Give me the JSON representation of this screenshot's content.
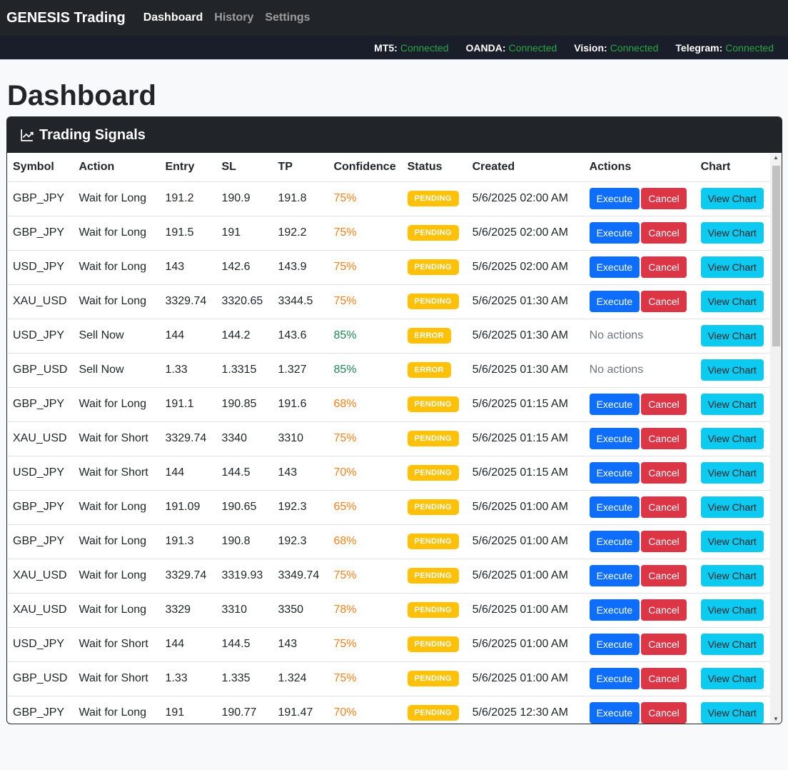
{
  "nav": {
    "brand": "GENESIS Trading",
    "links": [
      "Dashboard",
      "History",
      "Settings"
    ]
  },
  "status": [
    {
      "key": "MT5:",
      "value": "Connected"
    },
    {
      "key": "OANDA:",
      "value": "Connected"
    },
    {
      "key": "Vision:",
      "value": "Connected"
    },
    {
      "key": "Telegram:",
      "value": "Connected"
    }
  ],
  "page_title": "Dashboard",
  "card_title": "Trading Signals",
  "columns": [
    "Symbol",
    "Action",
    "Entry",
    "SL",
    "TP",
    "Confidence",
    "Status",
    "Created",
    "Actions",
    "Chart"
  ],
  "labels": {
    "execute": "Execute",
    "cancel": "Cancel",
    "view_chart": "View Chart",
    "no_actions": "No actions"
  },
  "rows": [
    {
      "symbol": "GBP_JPY",
      "action": "Wait for Long",
      "entry": "191.2",
      "sl": "190.9",
      "tp": "191.8",
      "confidence": "75%",
      "status": "PENDING",
      "created": "5/6/2025 02:00 AM"
    },
    {
      "symbol": "GBP_JPY",
      "action": "Wait for Long",
      "entry": "191.5",
      "sl": "191",
      "tp": "192.2",
      "confidence": "75%",
      "status": "PENDING",
      "created": "5/6/2025 02:00 AM"
    },
    {
      "symbol": "USD_JPY",
      "action": "Wait for Long",
      "entry": "143",
      "sl": "142.6",
      "tp": "143.9",
      "confidence": "75%",
      "status": "PENDING",
      "created": "5/6/2025 02:00 AM"
    },
    {
      "symbol": "XAU_USD",
      "action": "Wait for Long",
      "entry": "3329.74",
      "sl": "3320.65",
      "tp": "3344.5",
      "confidence": "75%",
      "status": "PENDING",
      "created": "5/6/2025 01:30 AM"
    },
    {
      "symbol": "USD_JPY",
      "action": "Sell Now",
      "entry": "144",
      "sl": "144.2",
      "tp": "143.6",
      "confidence": "85%",
      "status": "ERROR",
      "created": "5/6/2025 01:30 AM"
    },
    {
      "symbol": "GBP_USD",
      "action": "Sell Now",
      "entry": "1.33",
      "sl": "1.3315",
      "tp": "1.327",
      "confidence": "85%",
      "status": "ERROR",
      "created": "5/6/2025 01:30 AM"
    },
    {
      "symbol": "GBP_JPY",
      "action": "Wait for Long",
      "entry": "191.1",
      "sl": "190.85",
      "tp": "191.6",
      "confidence": "68%",
      "status": "PENDING",
      "created": "5/6/2025 01:15 AM"
    },
    {
      "symbol": "XAU_USD",
      "action": "Wait for Short",
      "entry": "3329.74",
      "sl": "3340",
      "tp": "3310",
      "confidence": "75%",
      "status": "PENDING",
      "created": "5/6/2025 01:15 AM"
    },
    {
      "symbol": "USD_JPY",
      "action": "Wait for Short",
      "entry": "144",
      "sl": "144.5",
      "tp": "143",
      "confidence": "70%",
      "status": "PENDING",
      "created": "5/6/2025 01:15 AM"
    },
    {
      "symbol": "GBP_JPY",
      "action": "Wait for Long",
      "entry": "191.09",
      "sl": "190.65",
      "tp": "192.3",
      "confidence": "65%",
      "status": "PENDING",
      "created": "5/6/2025 01:00 AM"
    },
    {
      "symbol": "GBP_JPY",
      "action": "Wait for Long",
      "entry": "191.3",
      "sl": "190.8",
      "tp": "192.3",
      "confidence": "68%",
      "status": "PENDING",
      "created": "5/6/2025 01:00 AM"
    },
    {
      "symbol": "XAU_USD",
      "action": "Wait for Long",
      "entry": "3329.74",
      "sl": "3319.93",
      "tp": "3349.74",
      "confidence": "75%",
      "status": "PENDING",
      "created": "5/6/2025 01:00 AM"
    },
    {
      "symbol": "XAU_USD",
      "action": "Wait for Long",
      "entry": "3329",
      "sl": "3310",
      "tp": "3350",
      "confidence": "78%",
      "status": "PENDING",
      "created": "5/6/2025 01:00 AM"
    },
    {
      "symbol": "USD_JPY",
      "action": "Wait for Short",
      "entry": "144",
      "sl": "144.5",
      "tp": "143",
      "confidence": "75%",
      "status": "PENDING",
      "created": "5/6/2025 01:00 AM"
    },
    {
      "symbol": "GBP_USD",
      "action": "Wait for Short",
      "entry": "1.33",
      "sl": "1.335",
      "tp": "1.324",
      "confidence": "75%",
      "status": "PENDING",
      "created": "5/6/2025 01:00 AM"
    },
    {
      "symbol": "GBP_JPY",
      "action": "Wait for Long",
      "entry": "191",
      "sl": "190.77",
      "tp": "191.47",
      "confidence": "70%",
      "status": "PENDING",
      "created": "5/6/2025 12:30 AM"
    }
  ],
  "colors": {
    "confidence_medium": "#fd7e14",
    "confidence_high": "#198754",
    "badge": "#ffc107"
  }
}
